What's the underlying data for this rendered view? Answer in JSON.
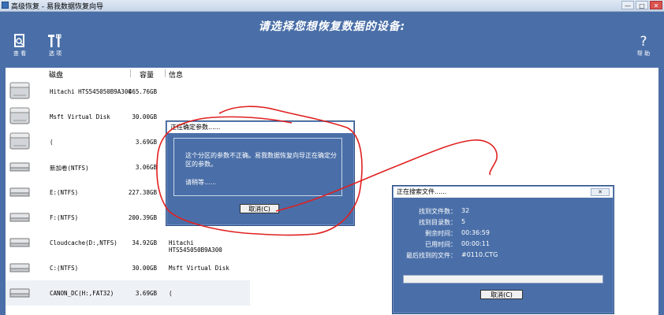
{
  "window": {
    "title": "高级恢复 - 易我数据恢复向导",
    "minimize": "—",
    "maximize": "□",
    "close": "✕"
  },
  "headline": "请选择您想恢复数据的设备:",
  "toolbar": {
    "view_label": "查 看",
    "options_label": "选 项",
    "help_label": "帮 助"
  },
  "columns": {
    "disk": "磁盘",
    "capacity": "容量",
    "info": "信息"
  },
  "disks": [
    {
      "name": "Hitachi HTS545050B9A300",
      "capacity": "465.76GB",
      "info": "",
      "type": "physical"
    },
    {
      "name": "Msft Virtual Disk",
      "capacity": "30.00GB",
      "info": "",
      "type": "physical"
    },
    {
      "name": "(",
      "capacity": "3.69GB",
      "info": "",
      "type": "physical"
    },
    {
      "name": "新加卷(NTFS)",
      "capacity": "3.06GB",
      "info": "",
      "type": "partition"
    },
    {
      "name": "E:(NTFS)",
      "capacity": "227.38GB",
      "info": "",
      "type": "partition"
    },
    {
      "name": "F:(NTFS)",
      "capacity": "200.39GB",
      "info": "",
      "type": "partition"
    },
    {
      "name": "Cloudcache(D:,NTFS)",
      "capacity": "34.92GB",
      "info": "Hitachi HTS545050B9A300",
      "type": "partition"
    },
    {
      "name": "C:(NTFS)",
      "capacity": "30.00GB",
      "info": "Msft Virtual Disk",
      "type": "partition"
    },
    {
      "name": "CANON_DC(H:,FAT32)",
      "capacity": "3.69GB",
      "info": "(",
      "type": "partition"
    }
  ],
  "confirm_dialog": {
    "title": "正在确定参数......",
    "message_line1": "这个分区的参数不正确。易我数据恢复向导正在确定分",
    "message_line2": "区的参数。",
    "wait": "请稍等......",
    "cancel": "取消(C)"
  },
  "search_dialog": {
    "title": "正在搜索文件......",
    "files_found_label": "找到文件数：",
    "files_found": "32",
    "dirs_found_label": "找到目录数：",
    "dirs_found": "5",
    "remaining_label": "剩余时间：",
    "remaining": "00:36:59",
    "elapsed_label": "已用时间：",
    "elapsed": "00:00:11",
    "last_file_label": "最后找到的文件：",
    "last_file": "#0110.CTG",
    "progress": 0,
    "cancel": "取消(C)"
  },
  "colors": {
    "background": "#4a6fa8",
    "annotation": "#e02020"
  }
}
